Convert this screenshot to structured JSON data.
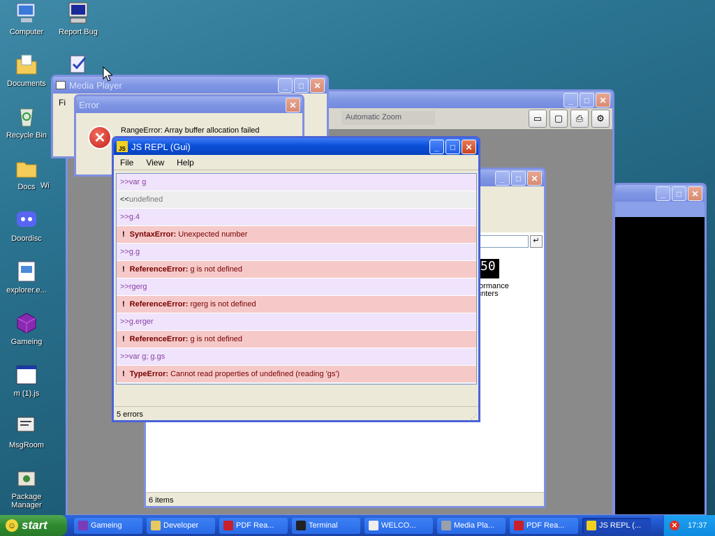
{
  "desktop": {
    "icons": [
      {
        "label": "Computer"
      },
      {
        "label": "Report Bug"
      },
      {
        "label": "Documents"
      },
      {
        "label": "Recycle Bin"
      },
      {
        "label": "Docs"
      },
      {
        "label": "Doordisc"
      },
      {
        "label": "explorer.e..."
      },
      {
        "label": "Gameing"
      },
      {
        "label": "m (1).js"
      },
      {
        "label": "MsgRoom"
      },
      {
        "label": "Package Manager"
      },
      {
        "label": "Wi"
      }
    ]
  },
  "media_player": {
    "title": "Media Player",
    "menu_first": "Fi"
  },
  "error_dialog": {
    "title": "Error",
    "message": "RangeError: Array buffer allocation failed"
  },
  "pdf_window": {
    "zoom_label": "Automatic Zoom"
  },
  "explorer_window": {
    "status": "6 items",
    "counter_digits": "50",
    "counter_label1": "formance",
    "counter_label2": "unters"
  },
  "repl": {
    "title": "JS REPL (Gui)",
    "menu": [
      "File",
      "View",
      "Help"
    ],
    "rows": [
      {
        "kind": "in",
        "prefix": ">>",
        "text": "var g"
      },
      {
        "kind": "out",
        "prefix": "<<",
        "text": "undefined"
      },
      {
        "kind": "in",
        "prefix": ">>",
        "text": "g.4"
      },
      {
        "kind": "err",
        "bang": "!",
        "name": "SyntaxError:",
        "text": "Unexpected number"
      },
      {
        "kind": "in",
        "prefix": ">>",
        "text": "g.g"
      },
      {
        "kind": "err",
        "bang": "!",
        "name": "ReferenceError:",
        "text": "g is not defined"
      },
      {
        "kind": "in",
        "prefix": ">>",
        "text": "rgerg"
      },
      {
        "kind": "err",
        "bang": "!",
        "name": "ReferenceError:",
        "text": "rgerg is not defined"
      },
      {
        "kind": "in",
        "prefix": ">>",
        "text": "g.erger"
      },
      {
        "kind": "err",
        "bang": "!",
        "name": "ReferenceError:",
        "text": "g is not defined"
      },
      {
        "kind": "in",
        "prefix": ">>",
        "text": "var g; g.gs"
      },
      {
        "kind": "err",
        "bang": "!",
        "name": "TypeError:",
        "text": "Cannot read properties of undefined (reading 'gs')"
      }
    ],
    "status": "5 errors"
  },
  "taskbar": {
    "start_label": "start",
    "tasks": [
      {
        "label": "Gameing",
        "color": "#7a3bb8"
      },
      {
        "label": "Developer",
        "color": "#e8c860"
      },
      {
        "label": "PDF Rea...",
        "color": "#c8202a"
      },
      {
        "label": "Terminal",
        "color": "#222222"
      },
      {
        "label": "WELCO...",
        "color": "#eeeeee"
      },
      {
        "label": "Media Pla...",
        "color": "#9aa0a8"
      },
      {
        "label": "PDF Rea...",
        "color": "#c8202a"
      },
      {
        "label": "JS REPL (...",
        "color": "#f0d020"
      }
    ],
    "clock": "17:37"
  },
  "colors": {
    "title_active": "#0a50d8",
    "title_inactive": "#7f96e4",
    "error_bg": "#f6c9c9",
    "input_bg": "#efe4fb"
  }
}
